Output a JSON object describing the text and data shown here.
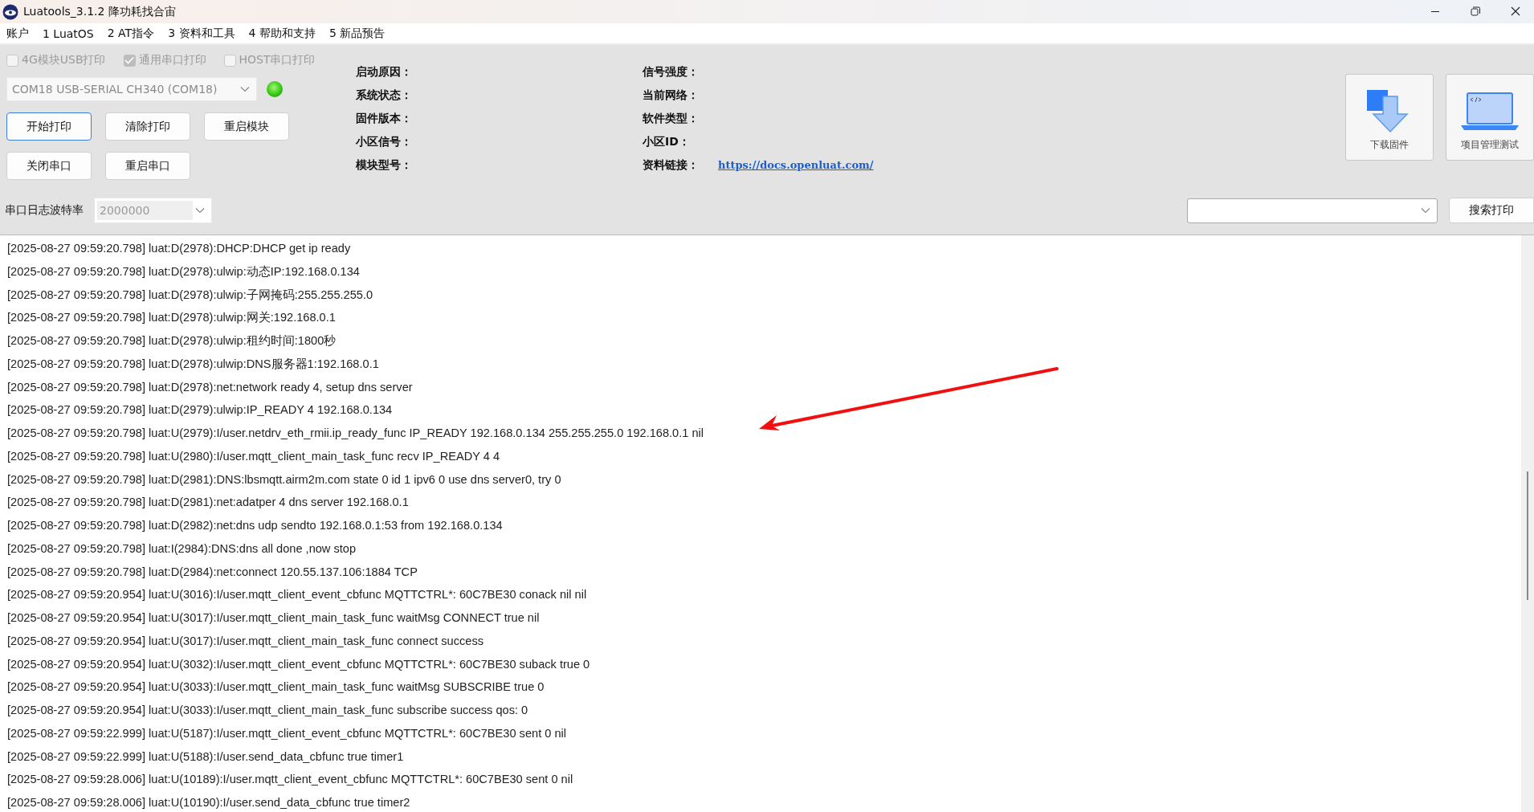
{
  "window": {
    "title": "Luatools_3.1.2 降功耗找合宙"
  },
  "menu": [
    "账户",
    "1 LuatOS",
    "2 AT指令",
    "3 资料和工具",
    "4 帮助和支持",
    "5 新品预告"
  ],
  "print_options": [
    {
      "label": "4G模块USB打印",
      "checked": false,
      "disabled": true
    },
    {
      "label": "通用串口打印",
      "checked": true,
      "disabled": true
    },
    {
      "label": "HOST串口打印",
      "checked": false,
      "disabled": true
    }
  ],
  "port": {
    "value": "COM18 USB-SERIAL CH340 (COM18)",
    "connected": true
  },
  "buttons": [
    [
      {
        "label": "开始打印",
        "focused": true
      },
      {
        "label": "清除打印",
        "focused": false
      },
      {
        "label": "重启模块",
        "focused": false
      }
    ],
    [
      {
        "label": "关闭串口",
        "focused": false
      },
      {
        "label": "重启串口",
        "focused": false
      }
    ]
  ],
  "info_columns": [
    [
      {
        "label": "启动原因："
      },
      {
        "label": "系统状态："
      },
      {
        "label": "固件版本："
      },
      {
        "label": "小区信号："
      },
      {
        "label": "模块型号："
      }
    ],
    [
      {
        "label": "信号强度："
      },
      {
        "label": "当前网络："
      },
      {
        "label": "软件类型："
      },
      {
        "label": "小区ID："
      },
      {
        "label": "资料链接：",
        "link": "https://docs.openluat.com/"
      }
    ]
  ],
  "tools": [
    {
      "label": "下载固件",
      "kind": "download"
    },
    {
      "label": "项目管理测试",
      "kind": "project"
    }
  ],
  "baud": {
    "label": "串口日志波特率",
    "value": "2000000"
  },
  "search": {
    "button": "搜索打印"
  },
  "log": [
    "[2025-08-27 09:59:20.798] luat:D(2978):DHCP:DHCP get ip ready",
    "[2025-08-27 09:59:20.798] luat:D(2978):ulwip:动态IP:192.168.0.134",
    "[2025-08-27 09:59:20.798] luat:D(2978):ulwip:子网掩码:255.255.255.0",
    "[2025-08-27 09:59:20.798] luat:D(2978):ulwip:网关:192.168.0.1",
    "[2025-08-27 09:59:20.798] luat:D(2978):ulwip:租约时间:1800秒",
    "[2025-08-27 09:59:20.798] luat:D(2978):ulwip:DNS服务器1:192.168.0.1",
    "[2025-08-27 09:59:20.798] luat:D(2978):net:network ready 4, setup dns server",
    "[2025-08-27 09:59:20.798] luat:D(2979):ulwip:IP_READY 4 192.168.0.134",
    "[2025-08-27 09:59:20.798] luat:U(2979):I/user.netdrv_eth_rmii.ip_ready_func IP_READY 192.168.0.134 255.255.255.0 192.168.0.1 nil",
    "[2025-08-27 09:59:20.798] luat:U(2980):I/user.mqtt_client_main_task_func recv IP_READY 4 4",
    "[2025-08-27 09:59:20.798] luat:D(2981):DNS:lbsmqtt.airm2m.com state 0 id 1 ipv6 0 use dns server0, try 0",
    "[2025-08-27 09:59:20.798] luat:D(2981):net:adatper 4 dns server 192.168.0.1",
    "[2025-08-27 09:59:20.798] luat:D(2982):net:dns udp sendto 192.168.0.1:53 from 192.168.0.134",
    "[2025-08-27 09:59:20.798] luat:I(2984):DNS:dns all done ,now stop",
    "[2025-08-27 09:59:20.798] luat:D(2984):net:connect 120.55.137.106:1884 TCP",
    "[2025-08-27 09:59:20.954] luat:U(3016):I/user.mqtt_client_event_cbfunc MQTTCTRL*: 60C7BE30 conack nil nil",
    "[2025-08-27 09:59:20.954] luat:U(3017):I/user.mqtt_client_main_task_func waitMsg CONNECT true nil",
    "[2025-08-27 09:59:20.954] luat:U(3017):I/user.mqtt_client_main_task_func connect success",
    "[2025-08-27 09:59:20.954] luat:U(3032):I/user.mqtt_client_event_cbfunc MQTTCTRL*: 60C7BE30 suback true 0",
    "[2025-08-27 09:59:20.954] luat:U(3033):I/user.mqtt_client_main_task_func waitMsg SUBSCRIBE true 0",
    "[2025-08-27 09:59:20.954] luat:U(3033):I/user.mqtt_client_main_task_func subscribe success qos: 0",
    "[2025-08-27 09:59:22.999] luat:U(5187):I/user.mqtt_client_event_cbfunc MQTTCTRL*: 60C7BE30 sent 0 nil",
    "[2025-08-27 09:59:22.999] luat:U(5188):I/user.send_data_cbfunc true timer1",
    "[2025-08-27 09:59:28.006] luat:U(10189):I/user.mqtt_client_event_cbfunc MQTTCTRL*: 60C7BE30 sent 0 nil",
    "[2025-08-27 09:59:28.006] luat:U(10190):I/user.send_data_cbfunc true timer2"
  ]
}
